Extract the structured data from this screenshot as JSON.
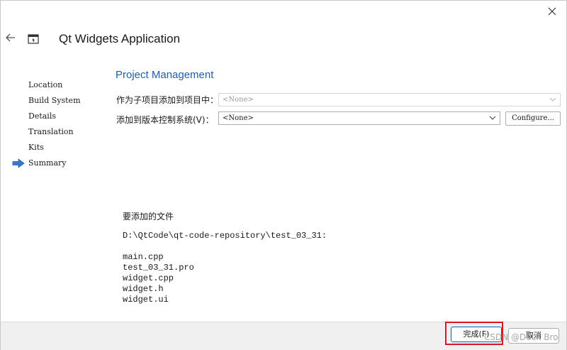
{
  "window": {
    "title": "Qt Widgets Application"
  },
  "steps": [
    {
      "label": "Location"
    },
    {
      "label": "Build System"
    },
    {
      "label": "Details"
    },
    {
      "label": "Translation"
    },
    {
      "label": "Kits"
    },
    {
      "label": "Summary",
      "current": true
    }
  ],
  "section_title": "Project Management",
  "add_subproject": {
    "label": "作为子项目添加到项目中：",
    "value": "<None>"
  },
  "version_control": {
    "label": "添加到版本控制系统(V)：",
    "value": "<None>",
    "configure_label": "Configure..."
  },
  "files": {
    "heading": "要添加的文件",
    "path": "D:\\QtCode\\qt-code-repository\\test_03_31:",
    "items": [
      "main.cpp",
      "test_03_31.pro",
      "widget.cpp",
      "widget.h",
      "widget.ui"
    ]
  },
  "footer": {
    "finish_label": "完成(F)",
    "cancel_label": "取消"
  },
  "watermark": "CSDN @Duck Bro",
  "colors": {
    "accent": "#1f5fa8",
    "highlight": "#e0141e",
    "step_arrow": "#3a78c9"
  }
}
